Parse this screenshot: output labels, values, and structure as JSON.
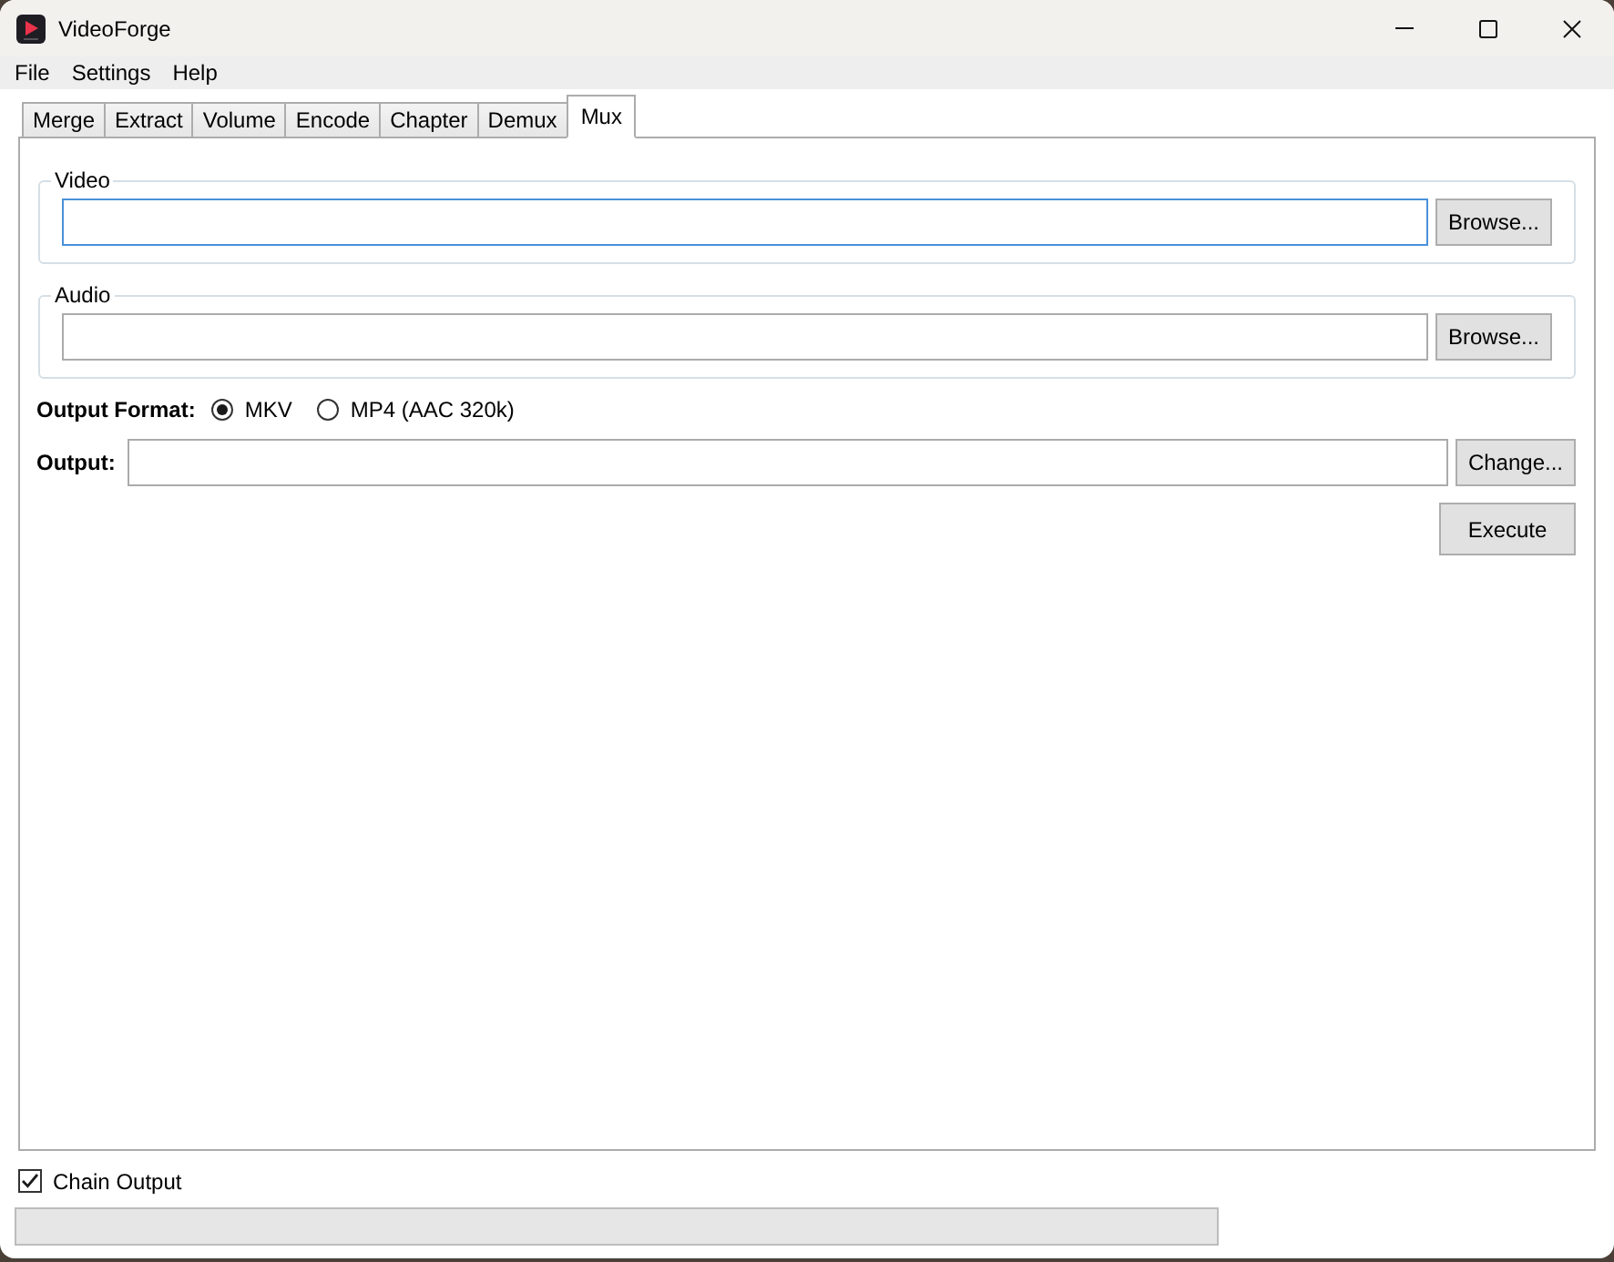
{
  "window": {
    "title": "VideoForge"
  },
  "menu": [
    "File",
    "Settings",
    "Help"
  ],
  "tabs": [
    {
      "label": "Merge",
      "selected": false
    },
    {
      "label": "Extract",
      "selected": false
    },
    {
      "label": "Volume",
      "selected": false
    },
    {
      "label": "Encode",
      "selected": false
    },
    {
      "label": "Chapter",
      "selected": false
    },
    {
      "label": "Demux",
      "selected": false
    },
    {
      "label": "Mux",
      "selected": true
    }
  ],
  "groups": [
    {
      "title": "Video",
      "focused": true,
      "button": "Browse..."
    },
    {
      "title": "Audio",
      "focused": false,
      "button": "Browse..."
    }
  ],
  "output_format": {
    "label": "Output Format:",
    "options": [
      {
        "label": "MKV",
        "selected": true
      },
      {
        "label": "MP4 (AAC 320k)",
        "selected": false
      }
    ]
  },
  "output": {
    "label": "Output:",
    "button": "Change..."
  },
  "execute_button": "Execute",
  "chain_output": {
    "label": "Chain Output",
    "checked": true
  },
  "progress": {
    "level": 0
  }
}
